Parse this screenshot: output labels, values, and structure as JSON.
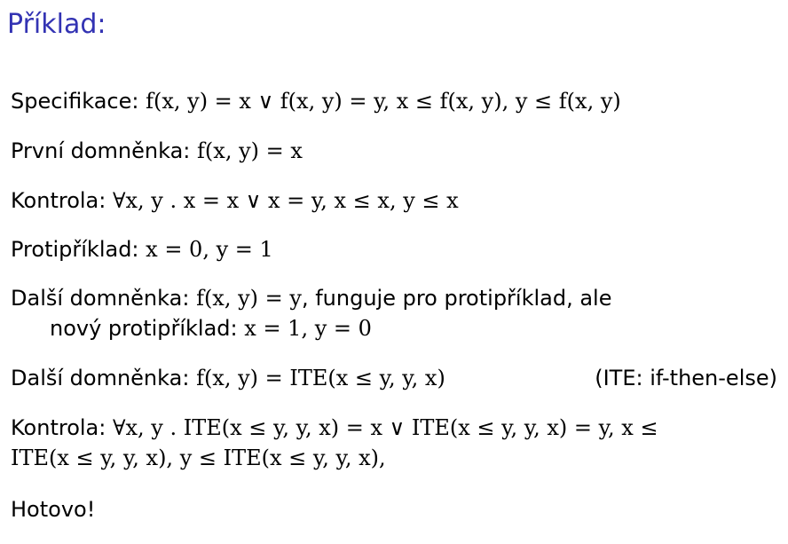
{
  "title": "Příklad:",
  "lines": [
    {
      "label": "Specifikace:",
      "math": "f(x, y) = x ∨ f(x, y) = y, x ≤ f(x, y), y ≤ f(x, y)"
    },
    {
      "label": "První domněnka:",
      "math": "f(x, y) = x"
    },
    {
      "label": "Kontrola:",
      "math": "∀x, y . x = x ∨ x = y, x ≤ x, y ≤ x"
    },
    {
      "label": "Protipříklad:",
      "math": "x = 0, y = 1"
    },
    {
      "label": "Další domněnka:",
      "math": "f(x, y) = y",
      "text": ", funguje pro protipříklad, ale"
    },
    {
      "label": "nový protipříklad:",
      "math": "x = 1, y = 0"
    },
    {
      "label": "Další domněnka:",
      "math": "f(x, y) = ITE(x ≤ y, y, x)",
      "note": "(ITE: if-then-else)"
    },
    {
      "label": "Kontrola:",
      "math": "∀x, y . ITE(x ≤ y, y, x) = x ∨ ITE(x ≤ y, y, x) = y, x ≤"
    },
    {
      "math": "ITE(x ≤ y, y, x), y ≤ ITE(x ≤ y, y, x),"
    },
    {
      "text": "Hotovo!"
    }
  ]
}
